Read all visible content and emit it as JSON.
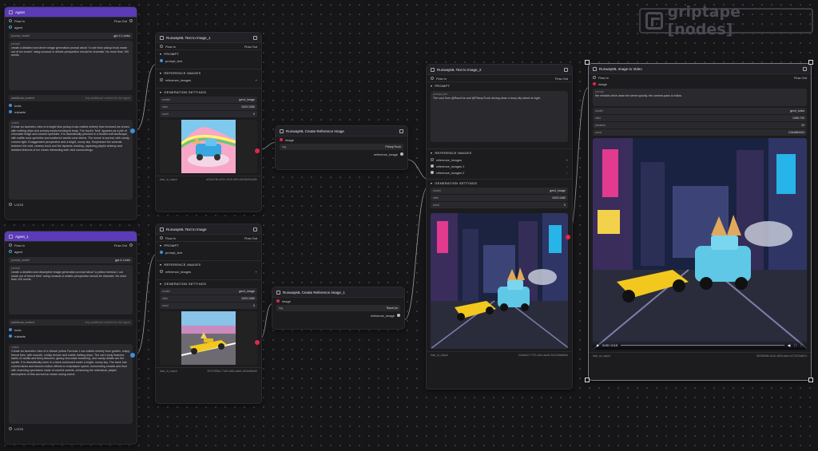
{
  "logo": {
    "text": "griptape [nodes]"
  },
  "agent1": {
    "title": "Agent",
    "flow_in": "Flow In",
    "flow_out": "Flow Out",
    "agent_label": "agent",
    "prompt_model_label": "prompt_model",
    "prompt_model_value": "gpt-4.1-turbo",
    "prompt_label": "prompt",
    "prompt_text": "create a detailed and clever image generation prompt about \"a cute blue pickup truck made out of ice cream\" using unusual or artistic perspective should be dramatic. No more than 100 words.",
    "context_label": "additional_context",
    "context_placeholder": "Any additional context for the Agent",
    "tools_label": "tools",
    "rulesets_label": "rulesets",
    "output_label": "output",
    "output_text": "Create an isometric view of a bright blue pickup truck crafted entirely from textured ice cream, with melting drips and creamy swirls forming its body. The truck's \"bed\" appears as a pile of chocolate fudge and colored sprinkles. It is dramatically perched in a frosted soft landscape, with waffle cone sprinkles and scattered vanilla cone debris. The scene is surreal, with candy-colored light. Exaggerated perspective and a bright, sunny sky. Emphasize the contrast between the cold, creamy truck and the dynamic shading, capturing playful whimsy and detailed textures of ice cream interacting with vivid surroundings.",
    "logs": "LOGS"
  },
  "agent2": {
    "title": "Agent_1",
    "flow_in": "Flow In",
    "flow_out": "Flow Out",
    "agent_label": "agent",
    "prompt_model_label": "prompt_model",
    "prompt_model_value": "gpt-4.1-mini",
    "prompt_label": "prompt",
    "prompt_text": "create a detailed and descriptive image generation prompt about \"a yellow formula 1 car made out of french fries\" using unusual or artistic perspective should be dramatic. No more than 100 words.",
    "context_label": "additional_context",
    "context_placeholder": "Any additional context for the Agent",
    "tools_label": "tools",
    "rulesets_label": "rulesets",
    "output_label": "output",
    "output_text": "Create an isometric view of a vibrant yellow Formula 1 car crafted entirely from golden, crispy french fries, with smooth, crinkly texture and subtle melting drips. The car's body features swirls of vanilla and berry-flavored, glossy chocolate bordering, and candy details are the spoiler. It is dramatically seen in a track cushioned under a bright, sunny sky. The track has colorful lanes and blurred motion effects to emphasize speed, surrounding crowds and floor with charming spectators made of colorful sweets, enhancing the whimsical, playful atmosphere of this surreal ice cream racing scene.",
    "logs": "LOGS"
  },
  "t2i_1": {
    "title": "RunwayML Text to Image_1",
    "flow_in": "Flow In",
    "flow_out": "Flow Out",
    "prompt_section": "PROMPT",
    "prompt_text_label": "prompt_text",
    "refs_section": "REFERENCE IMAGES",
    "refs_label": "reference_images",
    "gen_section": "GENERATION SETTINGS",
    "model_label": "model",
    "model_value": "gen4_image",
    "ratio_label": "ratio",
    "ratio_value": "1920:1080",
    "seed_label": "seed",
    "seed_value": "0",
    "output_label": "task_id_output",
    "output_value": "a032a78b-4009-4b38-96f0-66038e5c0d8e"
  },
  "t2i_2": {
    "title": "RunwayML Text to Image",
    "flow_in": "Flow In",
    "flow_out": "Flow Out",
    "prompt_section": "PROMPT",
    "prompt_text_label": "prompt_text",
    "refs_section": "REFERENCE IMAGES",
    "refs_label": "reference_images",
    "gen_section": "GENERATION SETTINGS",
    "model_label": "model",
    "model_value": "gen4_image",
    "ratio_label": "ratio",
    "ratio_value": "1920:1080",
    "seed_label": "seed",
    "seed_value": "0",
    "output_label": "task_id_output",
    "output_value": "39237896a-71a8-4d60-aa6d-40f4cf48a40"
  },
  "ref1": {
    "title": "RunwayML Create Reference Image",
    "image_label": "image",
    "tag_label": "tag",
    "tag_value": "PickupTruck",
    "ref_label": "reference_image"
  },
  "ref2": {
    "title": "RunwayML Create Reference Image_1",
    "image_label": "image",
    "tag_label": "tag",
    "tag_value": "RaceCar",
    "ref_label": "reference_image"
  },
  "t2i_3": {
    "title": "RunwayML Text to Image_2",
    "flow_in": "Flow In",
    "flow_out": "Flow Out",
    "prompt_section": "PROMPT",
    "prompt_text_label": "prompt_text",
    "prompt_text": "The cool from @RaceCar and @PickupTruck driving down a busy city street at night.",
    "refs_section": "REFERENCE IMAGES",
    "refs": [
      "reference_images",
      "reference_images 1",
      "reference_images 2"
    ],
    "gen_section": "GENERATION SETTINGS",
    "model_label": "model",
    "model_value": "gen4_image",
    "ratio_label": "ratio",
    "ratio_value": "1920:1080",
    "seed_label": "seed",
    "seed_value": "0",
    "output_label": "task_id_output",
    "output_value": "04a6e62-7703-4d1a-aea5-4d319dfa8d5a"
  },
  "i2v": {
    "title": "RunwayML Image to Video",
    "flow_in": "Flow In",
    "flow_out": "Flow Out",
    "image_label": "image",
    "prompt_label": "prompt",
    "prompt_text": "the vehicles drive down the street quickly. the camera pans to follow.",
    "model_label": "model",
    "model_value": "gen4_turbo",
    "ratio_label": "ratio",
    "ratio_value": "1280:720",
    "duration_label": "duration",
    "duration_value": "10",
    "seed_label": "seed",
    "seed_value": "2164883434",
    "time": "0:00 / 0:10",
    "output_label": "task_id_output",
    "output_value": "8b938d36-4a16-4690-afea-c472d74a8f14"
  }
}
